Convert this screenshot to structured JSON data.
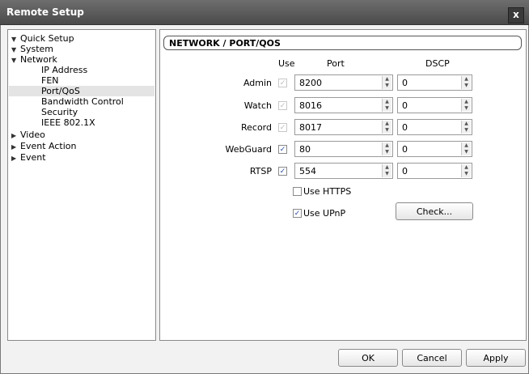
{
  "window": {
    "title": "Remote Setup",
    "close_label": "x"
  },
  "tree": {
    "items": [
      {
        "label": "Quick Setup",
        "arrow": "▼"
      },
      {
        "label": "System",
        "arrow": "▼"
      },
      {
        "label": "Network",
        "arrow": "▼"
      },
      {
        "label": "IP Address",
        "arrow": ""
      },
      {
        "label": "FEN",
        "arrow": ""
      },
      {
        "label": "Port/QoS",
        "arrow": "",
        "selected": true
      },
      {
        "label": "Bandwidth Control",
        "arrow": ""
      },
      {
        "label": "Security",
        "arrow": ""
      },
      {
        "label": "IEEE 802.1X",
        "arrow": ""
      },
      {
        "label": "Video",
        "arrow": "▶"
      },
      {
        "label": "Event Action",
        "arrow": "▶"
      },
      {
        "label": "Event",
        "arrow": "▶"
      }
    ]
  },
  "section": {
    "title": "NETWORK / PORT/QOS"
  },
  "columns": {
    "use": "Use",
    "port": "Port",
    "dscp": "DSCP"
  },
  "rows": [
    {
      "label": "Admin",
      "use_checked": true,
      "use_enabled": false,
      "port": "8200",
      "dscp": "0"
    },
    {
      "label": "Watch",
      "use_checked": true,
      "use_enabled": false,
      "port": "8016",
      "dscp": "0"
    },
    {
      "label": "Record",
      "use_checked": true,
      "use_enabled": false,
      "port": "8017",
      "dscp": "0"
    },
    {
      "label": "WebGuard",
      "use_checked": true,
      "use_enabled": true,
      "port": "80",
      "dscp": "0"
    },
    {
      "label": "RTSP",
      "use_checked": true,
      "use_enabled": true,
      "port": "554",
      "dscp": "0"
    }
  ],
  "options": {
    "use_https": {
      "label": "Use HTTPS",
      "checked": false
    },
    "use_upnp": {
      "label": "Use UPnP",
      "checked": true
    },
    "check_button": "Check..."
  },
  "footer": {
    "ok": "OK",
    "cancel": "Cancel",
    "apply": "Apply"
  },
  "icons": {
    "spin_up": "▲",
    "spin_down": "▼",
    "check": "✓"
  }
}
